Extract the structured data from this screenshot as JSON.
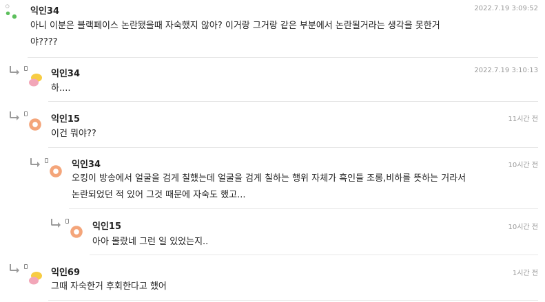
{
  "comments": [
    {
      "author": "익인34",
      "time": "2022.7.19 3:09:52",
      "lines": [
        "아니 이분은 블랙페이스 논란됐을때 자숙했지 않아? 이거랑 그거랑 같은 부분에서 논란될거라는 생각을 못한거",
        "야????"
      ],
      "avatar": "green-dots"
    },
    {
      "author": "익인34",
      "time": "2022.7.19 3:10:13",
      "lines": [
        "하...."
      ],
      "avatar": "yellow-pink"
    },
    {
      "author": "익인15",
      "time": "11시간 전",
      "lines": [
        "이건 뭐야??"
      ],
      "avatar": "orange-ring"
    },
    {
      "author": "익인34",
      "time": "10시간 전",
      "lines": [
        "오킹이 방송에서 얼굴을 검게 칠했는데 얼굴을 검게 칠하는 행위 자체가 흑인들 조롱,비하를 뜻하는 거라서",
        "논란되었던 적 있어 그것 때문에 자숙도 했고..."
      ],
      "avatar": "orange-ring"
    },
    {
      "author": "익인15",
      "time": "10시간 전",
      "lines": [
        "아아 몰랐네 그런 일 있었는지.."
      ],
      "avatar": "orange-ring"
    },
    {
      "author": "익인69",
      "time": "1시간 전",
      "lines": [
        "그때 자숙한거 후회한다고 했어"
      ],
      "avatar": "yellow-pink"
    }
  ],
  "colors": {
    "green": "#5cbf5c",
    "orange": "#f4a57a",
    "yellow": "#f7cc43",
    "pink": "#f2a6b8"
  }
}
